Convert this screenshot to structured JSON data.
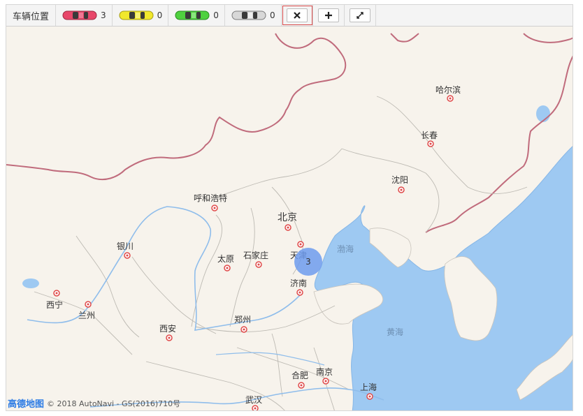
{
  "toolbar": {
    "title": "车辆位置",
    "car_groups": [
      {
        "color": "red",
        "count": "3"
      },
      {
        "color": "yellow",
        "count": "0"
      },
      {
        "color": "green",
        "count": "0"
      },
      {
        "color": "gray",
        "count": "0"
      }
    ]
  },
  "map": {
    "cities": {
      "harbin": "哈尔滨",
      "changchun": "长春",
      "shenyang": "沈阳",
      "hohhot": "呼和浩特",
      "beijing": "北京",
      "tianjin": "天津",
      "taiyuan": "太原",
      "shijiazhuang": "石家庄",
      "yinchuan": "银川",
      "jinan": "济南",
      "xining": "西宁",
      "lanzhou": "兰州",
      "xian": "西安",
      "zhengzhou": "郑州",
      "hefei": "合肥",
      "nanjing": "南京",
      "shanghai": "上海",
      "wuhan": "武汉"
    },
    "seas": {
      "bohai": "渤海",
      "huanghai": "黄海"
    },
    "cluster_count": "3"
  },
  "footer": {
    "logo": "高德地图",
    "copyright": "© 2018 AutoNavi - GS(2016)710号"
  }
}
